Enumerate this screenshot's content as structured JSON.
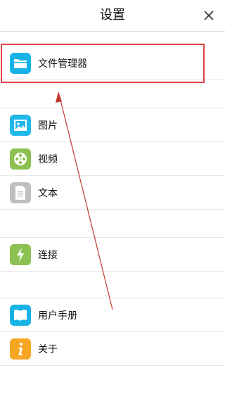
{
  "header": {
    "title": "设置",
    "close_icon": "close-icon"
  },
  "items": [
    {
      "label": "文件管理器",
      "icon": "folder-icon",
      "color": "#17b3e6"
    },
    {
      "label": "图片",
      "icon": "image-icon",
      "color": "#1fb8e8"
    },
    {
      "label": "视频",
      "icon": "film-reel-icon",
      "color": "#8cc152"
    },
    {
      "label": "文本",
      "icon": "document-icon",
      "color": "#bfbfbf"
    },
    {
      "label": "连接",
      "icon": "lightning-icon",
      "color": "#8cc152"
    },
    {
      "label": "用户手册",
      "icon": "book-icon",
      "color": "#17b3e6"
    },
    {
      "label": "关于",
      "icon": "info-icon",
      "color": "#f5a623"
    }
  ],
  "annotation": {
    "highlight_color": "#e0454b",
    "arrow_color": "#c0392b"
  }
}
